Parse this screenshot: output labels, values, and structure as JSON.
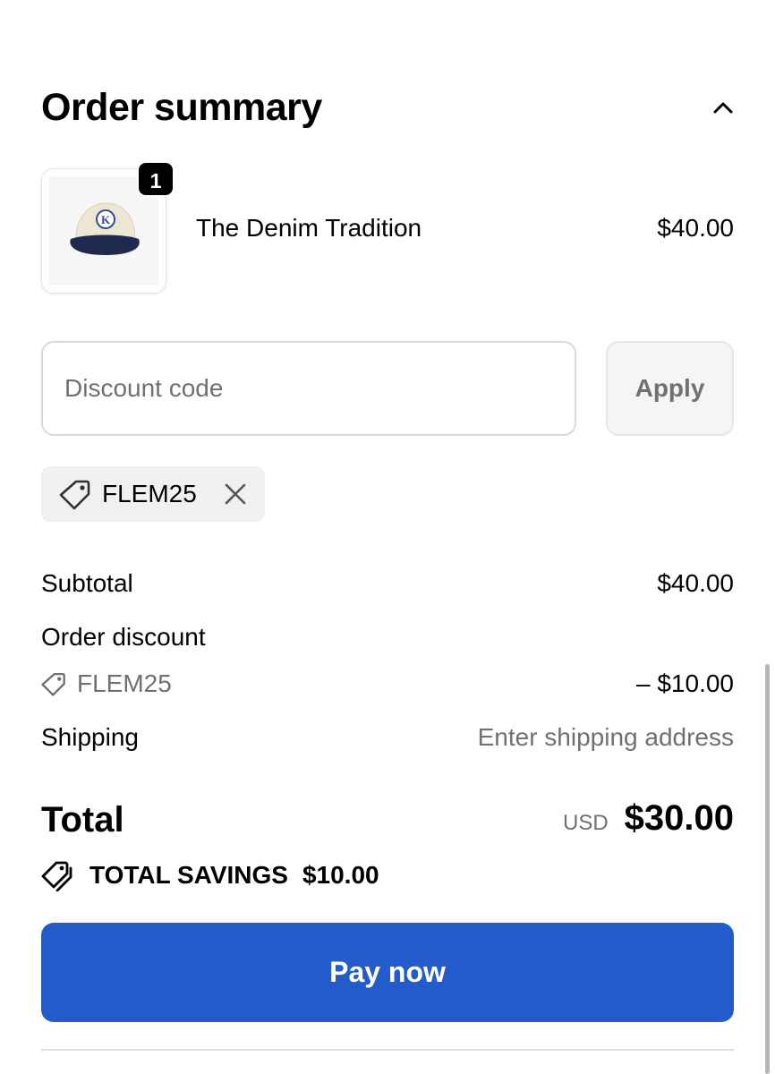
{
  "header": {
    "title": "Order summary",
    "toggle_icon": "chevron-up-icon"
  },
  "product": {
    "image_icon": "baseball-cap-image",
    "quantity": "1",
    "name": "The Denim Tradition",
    "price": "$40.00"
  },
  "discount": {
    "placeholder": "Discount code",
    "value": "",
    "apply_label": "Apply",
    "applied_code": "FLEM25",
    "tag_icon": "tag-icon",
    "remove_icon": "close-icon"
  },
  "summary": {
    "subtotal_label": "Subtotal",
    "subtotal_value": "$40.00",
    "order_discount_label": "Order discount",
    "order_discount_code": "FLEM25",
    "order_discount_value": "– $10.00",
    "shipping_label": "Shipping",
    "shipping_value": "Enter shipping address"
  },
  "total": {
    "label": "Total",
    "currency": "USD",
    "amount": "$30.00"
  },
  "savings": {
    "icon": "tags-icon",
    "label": "TOTAL SAVINGS",
    "amount": "$10.00"
  },
  "pay": {
    "label": "Pay now"
  },
  "colors": {
    "accent": "#245bca",
    "muted_text": "#707070",
    "chip_bg": "#f0f0f0"
  }
}
